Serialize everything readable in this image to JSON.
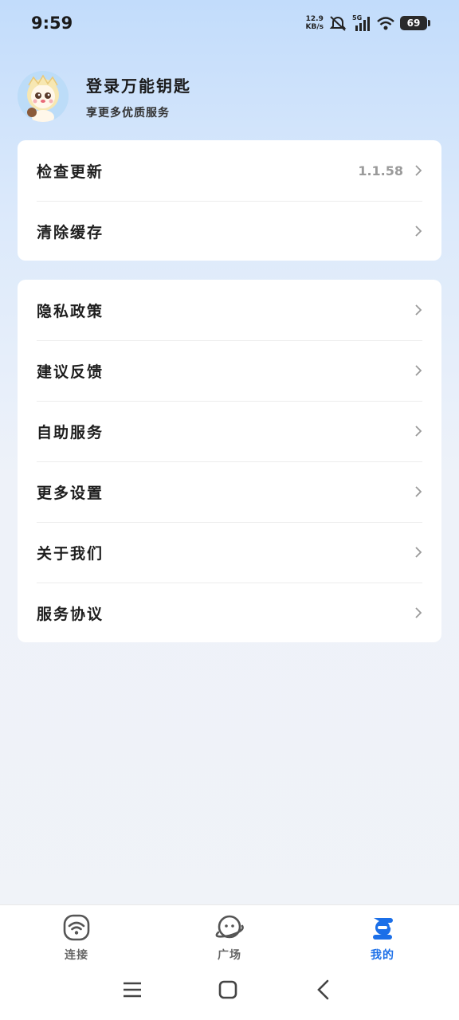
{
  "status_bar": {
    "time": "9:59",
    "net_speed_value": "12.9",
    "net_speed_unit": "KB/s",
    "network_type": "5G",
    "battery": "69"
  },
  "profile": {
    "title": "登录万能钥匙",
    "subtitle": "享更多优质服务"
  },
  "settings_group_1": [
    {
      "label": "检查更新",
      "value": "1.1.58"
    },
    {
      "label": "清除缓存",
      "value": ""
    }
  ],
  "settings_group_2": [
    {
      "label": "隐私政策"
    },
    {
      "label": "建议反馈"
    },
    {
      "label": "自助服务"
    },
    {
      "label": "更多设置"
    },
    {
      "label": "关于我们"
    },
    {
      "label": "服务协议"
    }
  ],
  "bottom_nav": [
    {
      "label": "连接",
      "icon": "wifi-icon",
      "active": false
    },
    {
      "label": "广场",
      "icon": "planet-icon",
      "active": false
    },
    {
      "label": "我的",
      "icon": "profile-icon",
      "active": true
    }
  ],
  "colors": {
    "accent": "#1b6fe8",
    "card_bg": "#ffffff",
    "page_bg_top": "#c2dcfb"
  }
}
